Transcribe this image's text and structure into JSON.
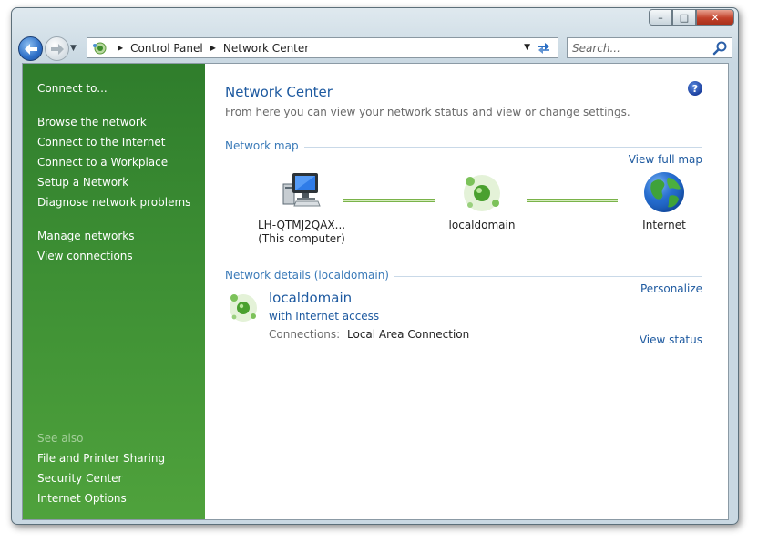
{
  "window": {
    "caption": {
      "minimize": "–",
      "maximize": "□",
      "close": "✕"
    }
  },
  "nav": {
    "breadcrumbs": [
      "Control Panel",
      "Network Center"
    ],
    "search_placeholder": "Search..."
  },
  "sidebar": {
    "tasks": [
      "Connect to...",
      "Browse the network",
      "Connect to the Internet",
      "Connect to a Workplace",
      "Setup a Network",
      "Diagnose network problems",
      "Manage networks",
      "View connections"
    ],
    "see_also_heading": "See also",
    "see_also": [
      "File and Printer Sharing",
      "Security Center",
      "Internet Options"
    ]
  },
  "main": {
    "title": "Network Center",
    "help_glyph": "?",
    "subtitle": "From here you can view your network status and view or change settings.",
    "network_map": {
      "heading": "Network map",
      "view_full_map": "View full map",
      "computer_name": "LH-QTMJ2QAX...",
      "computer_note": "(This computer)",
      "network_name": "localdomain",
      "internet_name": "Internet"
    },
    "network_details": {
      "heading": "Network details (localdomain)",
      "personalize": "Personalize",
      "name": "localdomain",
      "access": "with Internet access",
      "connections_label": "Connections:",
      "connections_value": "Local Area Connection",
      "view_status": "View status"
    }
  },
  "colors": {
    "sidebar_green": "#3d8f34",
    "link_blue": "#1e5aa0",
    "heading_blue": "#3a7ab8"
  }
}
